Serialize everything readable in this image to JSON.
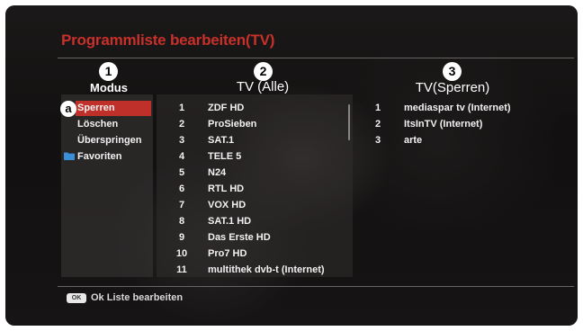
{
  "screen": {
    "title": "Programmliste bearbeiten(TV)",
    "accent_color": "#c0302a"
  },
  "columns": {
    "modus": {
      "marker": "1",
      "heading": "Modus"
    },
    "all": {
      "marker": "2",
      "heading": "TV (Alle)"
    },
    "locked": {
      "marker": "3",
      "heading": "TV(Sperren)"
    }
  },
  "modus": {
    "selected_marker": "a",
    "items": [
      {
        "label": "Sperren",
        "selected": true
      },
      {
        "label": "Löschen"
      },
      {
        "label": "Überspringen"
      },
      {
        "label": "Favoriten",
        "icon": "folder-icon"
      }
    ]
  },
  "all_channels": [
    {
      "num": "1",
      "name": "ZDF HD"
    },
    {
      "num": "2",
      "name": "ProSieben"
    },
    {
      "num": "3",
      "name": "SAT.1"
    },
    {
      "num": "4",
      "name": "TELE 5"
    },
    {
      "num": "5",
      "name": "N24"
    },
    {
      "num": "6",
      "name": "RTL HD"
    },
    {
      "num": "7",
      "name": "VOX HD"
    },
    {
      "num": "8",
      "name": "SAT.1 HD"
    },
    {
      "num": "9",
      "name": "Das Erste HD"
    },
    {
      "num": "10",
      "name": "Pro7 HD"
    },
    {
      "num": "11",
      "name": "multithek dvb-t (Internet)"
    }
  ],
  "locked_channels": [
    {
      "num": "1",
      "name": "mediaspar tv (Internet)"
    },
    {
      "num": "2",
      "name": "ItsInTV (Internet)"
    },
    {
      "num": "3",
      "name": "arte"
    }
  ],
  "footer": {
    "key": "OK",
    "label": "Ok Liste bearbeiten"
  }
}
